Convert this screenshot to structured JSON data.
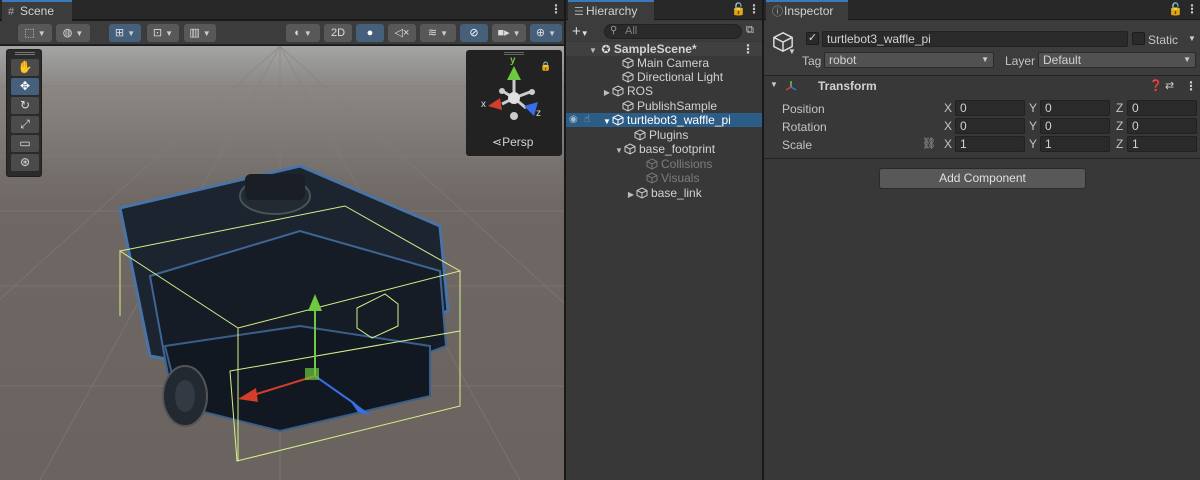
{
  "scene": {
    "tab_label": "Scene",
    "toolbar": {
      "mode_2d": "2D"
    },
    "gizmo": {
      "x": "x",
      "y": "y",
      "z": "z",
      "persp_label": "Persp"
    }
  },
  "hierarchy": {
    "tab_label": "Hierarchy",
    "search_placeholder": "All",
    "items": [
      {
        "label": "SampleScene*"
      },
      {
        "label": "Main Camera"
      },
      {
        "label": "Directional Light"
      },
      {
        "label": "ROS"
      },
      {
        "label": "PublishSample"
      },
      {
        "label": "turtlebot3_waffle_pi"
      },
      {
        "label": "Plugins"
      },
      {
        "label": "base_footprint"
      },
      {
        "label": "Collisions"
      },
      {
        "label": "Visuals"
      },
      {
        "label": "base_link"
      }
    ]
  },
  "inspector": {
    "tab_label": "Inspector",
    "object_name": "turtlebot3_waffle_pi",
    "static_label": "Static",
    "tag_label": "Tag",
    "tag_value": "robot",
    "layer_label": "Layer",
    "layer_value": "Default",
    "transform": {
      "title": "Transform",
      "position": {
        "label": "Position",
        "x": "0",
        "y": "0",
        "z": "0"
      },
      "rotation": {
        "label": "Rotation",
        "x": "0",
        "y": "0",
        "z": "0"
      },
      "scale": {
        "label": "Scale",
        "x": "1",
        "y": "1",
        "z": "1"
      },
      "axis_x": "X",
      "axis_y": "Y",
      "axis_z": "Z"
    },
    "add_component_label": "Add Component"
  },
  "colors": {
    "accent": "#3a79bb",
    "selection": "#2c5d87",
    "x_axis": "#d43d2a",
    "y_axis": "#6ec840",
    "z_axis": "#3a6ee8"
  }
}
